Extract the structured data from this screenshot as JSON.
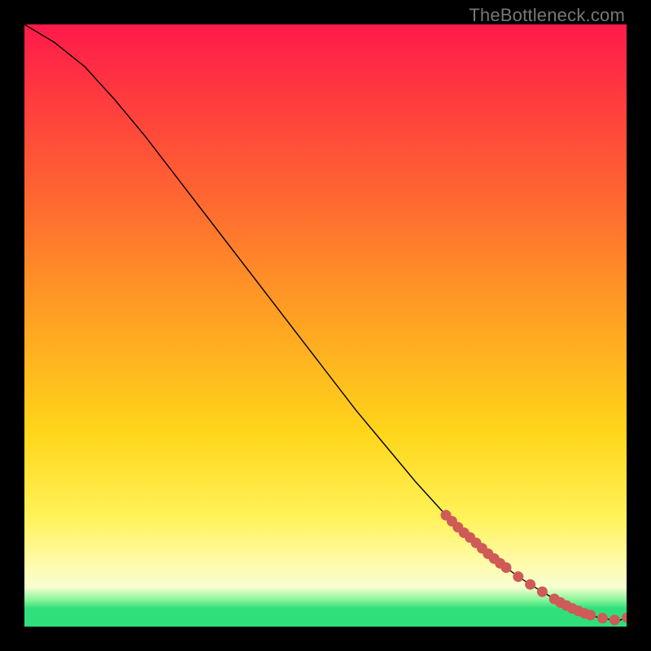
{
  "watermark": "TheBottleneck.com",
  "colors": {
    "frame": "#000000",
    "curve": "#000000",
    "marker": "#cf5a57",
    "gradient_stops": [
      "#ff1a4b",
      "#ff3a3f",
      "#ff6a30",
      "#ffa522",
      "#ffd61a",
      "#fff35a",
      "#fffbb0",
      "#f6ffd0",
      "#8cf59a",
      "#2fe07a"
    ]
  },
  "chart_data": {
    "type": "line",
    "title": "",
    "xlabel": "",
    "ylabel": "",
    "xlim": [
      0,
      100
    ],
    "ylim": [
      0,
      100
    ],
    "x": [
      0,
      5,
      10,
      15,
      20,
      25,
      30,
      35,
      40,
      45,
      50,
      55,
      60,
      65,
      70,
      72,
      74,
      76,
      78,
      80,
      82,
      84,
      86,
      88,
      90,
      91,
      92,
      93,
      94,
      95,
      96,
      97,
      98,
      99,
      100
    ],
    "y": [
      100,
      97,
      93,
      87.5,
      81.5,
      75,
      68.5,
      62,
      55.5,
      49,
      42.5,
      36,
      30,
      24,
      18.5,
      16.5,
      14.8,
      13,
      11.3,
      9.8,
      8.3,
      7,
      5.8,
      4.6,
      3.5,
      3,
      2.6,
      2.2,
      1.9,
      1.6,
      1.4,
      1.2,
      1.1,
      1.1,
      1.5
    ],
    "markers_x": [
      70,
      71,
      72,
      73,
      74,
      75,
      76,
      77,
      78,
      79,
      80,
      82,
      84,
      86,
      88,
      89,
      90,
      91,
      92,
      93,
      94,
      96,
      98,
      100
    ],
    "markers_y": [
      18.5,
      17.5,
      16.5,
      15.6,
      14.8,
      13.9,
      13,
      12.1,
      11.3,
      10.5,
      9.8,
      8.3,
      7,
      5.8,
      4.6,
      4,
      3.5,
      3,
      2.6,
      2.2,
      1.9,
      1.4,
      1.1,
      1.5
    ]
  }
}
